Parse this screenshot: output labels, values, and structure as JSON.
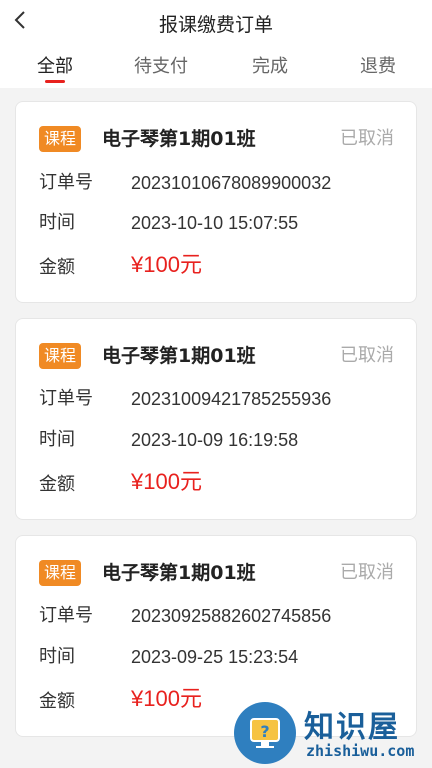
{
  "header": {
    "title": "报课缴费订单",
    "back_icon": "chevron-left-icon"
  },
  "tabs": [
    {
      "label": "全部",
      "active": true
    },
    {
      "label": "待支付",
      "active": false
    },
    {
      "label": "完成",
      "active": false
    },
    {
      "label": "退费",
      "active": false
    }
  ],
  "accent_color": "#e8211e",
  "badge_color": "#f08a24",
  "labels": {
    "order_no": "订单号",
    "time": "时间",
    "amount": "金额"
  },
  "orders": [
    {
      "badge": "课程",
      "course": "电子琴第1期01班",
      "status": "已取消",
      "order_no": "20231010678089900032",
      "time": "2023-10-10 15:07:55",
      "amount": "¥100元"
    },
    {
      "badge": "课程",
      "course": "电子琴第1期01班",
      "status": "已取消",
      "order_no": "20231009421785255936",
      "time": "2023-10-09 16:19:58",
      "amount": "¥100元"
    },
    {
      "badge": "课程",
      "course": "电子琴第1期01班",
      "status": "已取消",
      "order_no": "20230925882602745856",
      "time": "2023-09-25 15:23:54",
      "amount": "¥100元"
    }
  ],
  "watermark": {
    "name": "知识屋",
    "domain": "zhishiwu.com",
    "icon": "question-monitor-icon"
  }
}
